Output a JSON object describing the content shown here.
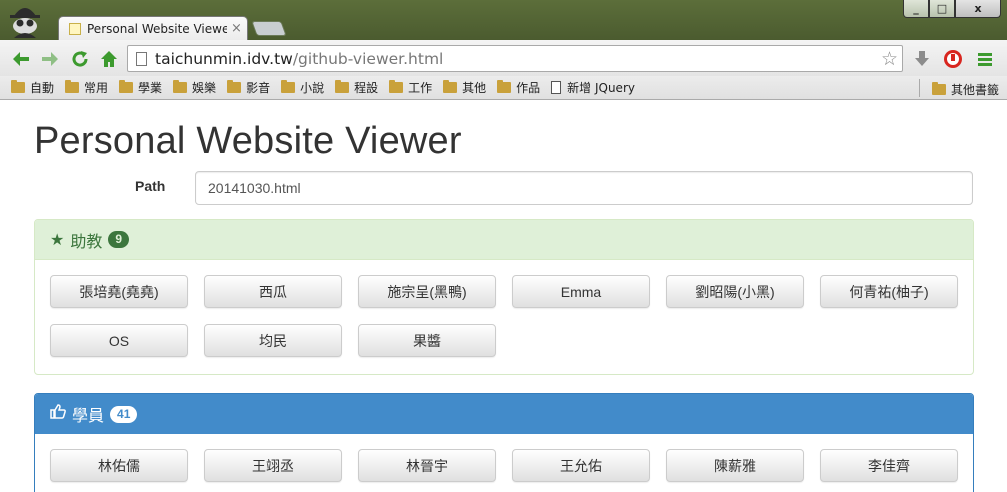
{
  "browser": {
    "tab_title": "Personal Website Viewer",
    "tab_close": "×",
    "url_host": "taichunmin.idv.tw",
    "url_path": "/github-viewer.html",
    "window_buttons": {
      "minimize": "_",
      "maximize": "□",
      "close": "x"
    },
    "nav_icons": [
      "back-icon",
      "forward-icon",
      "reload-icon",
      "home-icon"
    ],
    "bookmarks": [
      "自動",
      "常用",
      "學業",
      "娛樂",
      "影音",
      "小說",
      "程設",
      "工作",
      "其他",
      "作品"
    ],
    "bookmark_page": "新增 JQuery",
    "other_bookmarks": "其他書籤",
    "colors": {
      "frame": "#4a5a2e",
      "nav_green": "#3c9a2e"
    }
  },
  "page": {
    "title": "Personal Website Viewer",
    "path_label": "Path",
    "path_value": "20141030.html"
  },
  "panels": {
    "assistants": {
      "icon": "star-icon",
      "title": "助教",
      "count": "9",
      "buttons": [
        "張培堯(堯堯)",
        "西瓜",
        "施宗呈(黑鴨)",
        "Emma",
        "劉昭陽(小黑)",
        "何青祐(柚子)",
        "OS",
        "均民",
        "果醬"
      ]
    },
    "students": {
      "icon": "thumbs-up-icon",
      "title": "學員",
      "count": "41",
      "buttons": [
        "林佑儒",
        "王翊丞",
        "林晉宇",
        "王允佑",
        "陳薪雅",
        "李佳齊"
      ]
    }
  },
  "colors": {
    "success_bg": "#dff0d8",
    "success_text": "#3c763d",
    "primary_bg": "#428bca"
  }
}
